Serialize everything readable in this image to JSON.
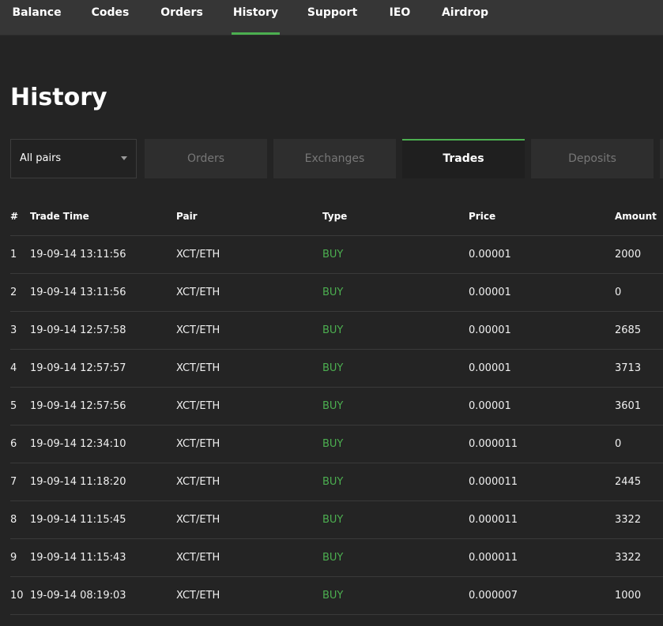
{
  "nav": {
    "items": [
      {
        "label": "Balance"
      },
      {
        "label": "Codes"
      },
      {
        "label": "Orders"
      },
      {
        "label": "History"
      },
      {
        "label": "Support"
      },
      {
        "label": "IEO"
      },
      {
        "label": "Airdrop"
      }
    ],
    "active": "History",
    "accent_color": "#4caf50"
  },
  "page": {
    "title": "History"
  },
  "filters": {
    "pair_select": {
      "selected": "All pairs",
      "icon": "chevron-down-icon"
    },
    "tabs": [
      {
        "label": "Orders",
        "active": false
      },
      {
        "label": "Exchanges",
        "active": false
      },
      {
        "label": "Trades",
        "active": true
      },
      {
        "label": "Deposits",
        "active": false
      }
    ]
  },
  "table": {
    "columns": [
      "#",
      "Trade Time",
      "Pair",
      "Type",
      "Price",
      "Amount"
    ],
    "rows": [
      {
        "num": "1",
        "time": "19-09-14 13:11:56",
        "pair": "XCT/ETH",
        "type": "BUY",
        "price": "0.00001",
        "amount": "2000"
      },
      {
        "num": "2",
        "time": "19-09-14 13:11:56",
        "pair": "XCT/ETH",
        "type": "BUY",
        "price": "0.00001",
        "amount": "0"
      },
      {
        "num": "3",
        "time": "19-09-14 12:57:58",
        "pair": "XCT/ETH",
        "type": "BUY",
        "price": "0.00001",
        "amount": "2685"
      },
      {
        "num": "4",
        "time": "19-09-14 12:57:57",
        "pair": "XCT/ETH",
        "type": "BUY",
        "price": "0.00001",
        "amount": "3713"
      },
      {
        "num": "5",
        "time": "19-09-14 12:57:56",
        "pair": "XCT/ETH",
        "type": "BUY",
        "price": "0.00001",
        "amount": "3601"
      },
      {
        "num": "6",
        "time": "19-09-14 12:34:10",
        "pair": "XCT/ETH",
        "type": "BUY",
        "price": "0.000011",
        "amount": "0"
      },
      {
        "num": "7",
        "time": "19-09-14 11:18:20",
        "pair": "XCT/ETH",
        "type": "BUY",
        "price": "0.000011",
        "amount": "2445"
      },
      {
        "num": "8",
        "time": "19-09-14 11:15:45",
        "pair": "XCT/ETH",
        "type": "BUY",
        "price": "0.000011",
        "amount": "3322"
      },
      {
        "num": "9",
        "time": "19-09-14 11:15:43",
        "pair": "XCT/ETH",
        "type": "BUY",
        "price": "0.000011",
        "amount": "3322"
      },
      {
        "num": "10",
        "time": "19-09-14 08:19:03",
        "pair": "XCT/ETH",
        "type": "BUY",
        "price": "0.000007",
        "amount": "1000"
      }
    ],
    "buy_color": "#4caf50"
  }
}
